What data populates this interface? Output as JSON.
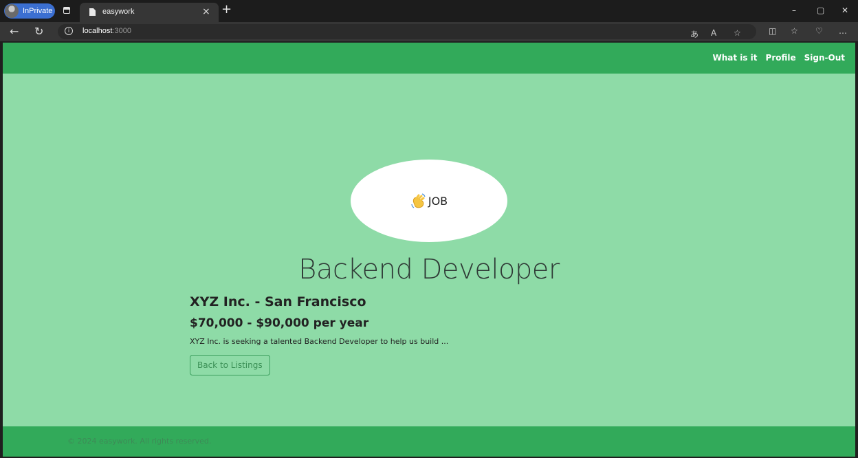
{
  "browser": {
    "profile_label": "InPrivate",
    "tab_title": "easywork",
    "tab_close": "×",
    "new_tab": "+",
    "url_host": "localhost",
    "url_port": ":3000",
    "window_controls": {
      "minimize": "–",
      "restore": "▢",
      "close": "✕"
    }
  },
  "navbar": {
    "links": [
      "What is it",
      "Profile",
      "Sign-Out"
    ]
  },
  "logo": {
    "text": "JOB",
    "icon": "waving-hand-icon"
  },
  "job": {
    "title": "Backend Developer",
    "company_location": "XYZ Inc. - San Francisco",
    "salary": "$70,000 - $90,000 per year",
    "description": "XYZ Inc. is seeking a talented Backend Developer to help us build ...",
    "back_button": "Back to Listings"
  },
  "footer": {
    "text": "© 2024 easywork. All rights reserved."
  },
  "colors": {
    "navbar": "#32aa5a",
    "page_background": "#8edba7",
    "footer": "#32aa5a"
  }
}
